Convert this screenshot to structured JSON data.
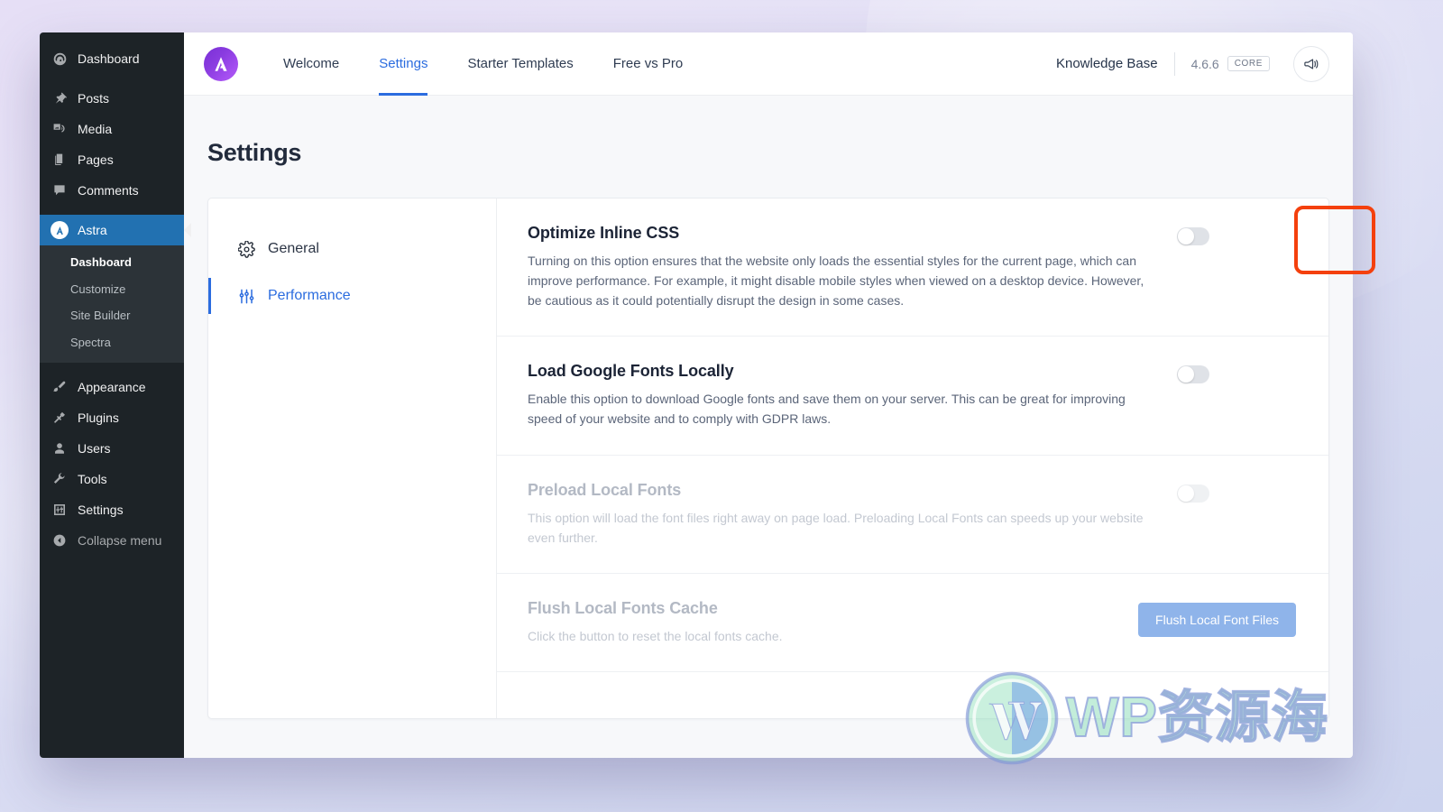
{
  "admin_sidebar": {
    "items": [
      {
        "label": "Dashboard",
        "icon": "dashboard-icon"
      },
      {
        "label": "Posts",
        "icon": "pin-icon"
      },
      {
        "label": "Media",
        "icon": "media-icon"
      },
      {
        "label": "Pages",
        "icon": "pages-icon"
      },
      {
        "label": "Comments",
        "icon": "comment-icon"
      },
      {
        "label": "Astra",
        "icon": "astra-icon"
      }
    ],
    "submenu": [
      {
        "label": "Dashboard",
        "current": true
      },
      {
        "label": "Customize",
        "current": false
      },
      {
        "label": "Site Builder",
        "current": false
      },
      {
        "label": "Spectra",
        "current": false
      }
    ],
    "items_lower": [
      {
        "label": "Appearance",
        "icon": "brush-icon"
      },
      {
        "label": "Plugins",
        "icon": "plug-icon"
      },
      {
        "label": "Users",
        "icon": "user-icon"
      },
      {
        "label": "Tools",
        "icon": "wrench-icon"
      },
      {
        "label": "Settings",
        "icon": "sliders-icon"
      }
    ],
    "collapse_label": "Collapse menu"
  },
  "topbar": {
    "logo": "astra-logo-icon",
    "tabs": [
      {
        "label": "Welcome",
        "active": false
      },
      {
        "label": "Settings",
        "active": true
      },
      {
        "label": "Starter Templates",
        "active": false
      },
      {
        "label": "Free vs Pro",
        "active": false
      }
    ],
    "knowledge_base": "Knowledge Base",
    "version": "4.6.6",
    "edition_badge": "CORE",
    "megaphone": "megaphone-icon"
  },
  "page": {
    "title": "Settings"
  },
  "settings_menu": [
    {
      "label": "General",
      "icon": "gear-icon",
      "active": false
    },
    {
      "label": "Performance",
      "icon": "sliders-icon",
      "active": true
    }
  ],
  "settings_rows": [
    {
      "title": "Optimize Inline CSS",
      "description": "Turning on this option ensures that the website only loads the essential styles for the current page, which can improve performance. For example, it might disable mobile styles when viewed on a desktop device. However, be cautious as it could potentially disrupt the design in some cases.",
      "control": "toggle",
      "toggle_state": "off",
      "disabled": false,
      "highlighted": true
    },
    {
      "title": "Load Google Fonts Locally",
      "description": "Enable this option to download Google fonts and save them on your server. This can be great for improving speed of your website and to comply with GDPR laws.",
      "control": "toggle",
      "toggle_state": "off",
      "disabled": false,
      "highlighted": false
    },
    {
      "title": "Preload Local Fonts",
      "description": "This option will load the font files right away on page load. Preloading Local Fonts can speeds up your website even further.",
      "control": "toggle",
      "toggle_state": "off",
      "disabled": true,
      "highlighted": false
    },
    {
      "title": "Flush Local Fonts Cache",
      "description": "Click the button to reset the local fonts cache.",
      "control": "button",
      "button_label": "Flush Local Font Files",
      "disabled": true,
      "highlighted": false
    }
  ],
  "watermark": {
    "logo": "wordpress-logo-icon",
    "text": "WP资源海"
  },
  "colors": {
    "accent_blue": "#2b6cdf",
    "wp_admin_blue": "#2271b1",
    "sidebar_bg": "#1d2327",
    "highlight_red": "#f4400d",
    "button_blue": "#8fb4ea"
  }
}
